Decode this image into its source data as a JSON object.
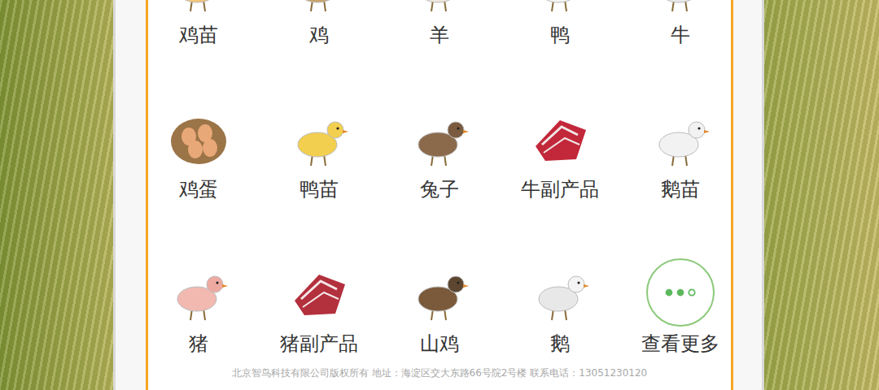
{
  "items": [
    {
      "label": "鸡苗"
    },
    {
      "label": "鸡"
    },
    {
      "label": "羊"
    },
    {
      "label": "鸭"
    },
    {
      "label": "牛"
    },
    {
      "label": "鸡蛋"
    },
    {
      "label": "鸭苗"
    },
    {
      "label": "兔子"
    },
    {
      "label": "牛副产品"
    },
    {
      "label": "鹅苗"
    },
    {
      "label": "猪"
    },
    {
      "label": "猪副产品"
    },
    {
      "label": "山鸡"
    },
    {
      "label": "鹅"
    }
  ],
  "more": {
    "label": "查看更多"
  },
  "footer": "北京智鸟科技有限公司版权所有 地址：海淀区交大东路66号院2号楼 联系电话：13051230120"
}
